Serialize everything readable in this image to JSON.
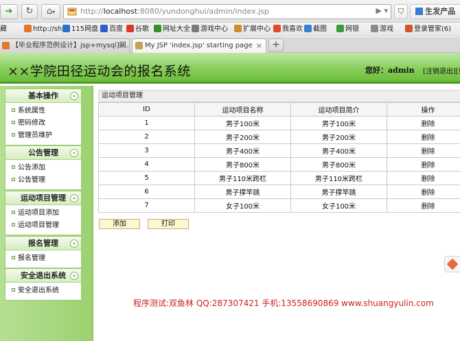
{
  "browser": {
    "address": {
      "prefix": "http://",
      "host": "localhost",
      "rest": ":8080/yundonghui/admin/index.jsp"
    },
    "profile_label": "生发产品",
    "bookmarks": [
      {
        "label": "藏",
        "color": "#ffffff"
      },
      {
        "label": "http://sh",
        "color": "#e8742d"
      },
      {
        "label": "115网盘",
        "color": "#2a6fc9"
      },
      {
        "label": "百度",
        "color": "#2b5ecf"
      },
      {
        "label": "谷歌",
        "color": "#d93b2b"
      },
      {
        "label": "网址大全",
        "color": "#3b8e2b"
      },
      {
        "label": "游戏中心",
        "color": "#7a7a7a"
      },
      {
        "label": "扩展中心",
        "color": "#c9902a"
      },
      {
        "label": "我喜欢",
        "color": "#e04a2a"
      },
      {
        "label": "截图",
        "color": "#3a7ed0"
      },
      {
        "label": "网银",
        "color": "#3b9a3b"
      },
      {
        "label": "游戏",
        "color": "#8a8a8a"
      },
      {
        "label": "登录管家(6)",
        "color": "#d0572a"
      }
    ],
    "tabs": [
      {
        "label": "【毕业程序范例设计】jsp+mysql]网...",
        "active": false,
        "color": "#e07a2a"
      },
      {
        "label": "My JSP 'index.jsp' starting page",
        "active": true,
        "color": "#c9a055"
      }
    ]
  },
  "header": {
    "title": "××学院田径运动会的报名系统",
    "greeting": "您好：admin",
    "logout": "[注销退出]",
    "logout_cut": "[更"
  },
  "sidebar": {
    "groups": [
      {
        "title": "基本操作",
        "items": [
          "系统属性",
          "密码修改",
          "管理员维护"
        ]
      },
      {
        "title": "公告管理",
        "items": [
          "公告添加",
          "公告管理"
        ]
      },
      {
        "title": "运动项目管理",
        "items": [
          "运动项目添加",
          "运动项目管理"
        ]
      },
      {
        "title": "报名管理",
        "items": [
          "报名管理"
        ]
      },
      {
        "title": "安全退出系统",
        "items": [
          "安全退出系统"
        ]
      }
    ],
    "collapse_glyph": "«"
  },
  "main": {
    "section_title": "运动项目管理",
    "columns": [
      "ID",
      "运动项目名称",
      "运动项目简介",
      "操作"
    ],
    "rows": [
      {
        "id": "1",
        "name": "男子100米",
        "desc": "男子100米",
        "op": "删除"
      },
      {
        "id": "2",
        "name": "男子200米",
        "desc": "男子200米",
        "op": "删除"
      },
      {
        "id": "3",
        "name": "男子400米",
        "desc": "男子400米",
        "op": "删除"
      },
      {
        "id": "4",
        "name": "男子800米",
        "desc": "男子800米",
        "op": "删除"
      },
      {
        "id": "5",
        "name": "男子110米跨栏",
        "desc": "男子110米跨栏",
        "op": "删除"
      },
      {
        "id": "6",
        "name": "男子撑竿跳",
        "desc": "男子撑竿跳",
        "op": "删除"
      },
      {
        "id": "7",
        "name": "女子100米",
        "desc": "女子100米",
        "op": "删除"
      }
    ],
    "add_button": "添加",
    "print_button": "打印"
  },
  "footer": "程序测试:双鱼林 QQ:287307421 手机:13558690869 www.shuangyulin.com"
}
